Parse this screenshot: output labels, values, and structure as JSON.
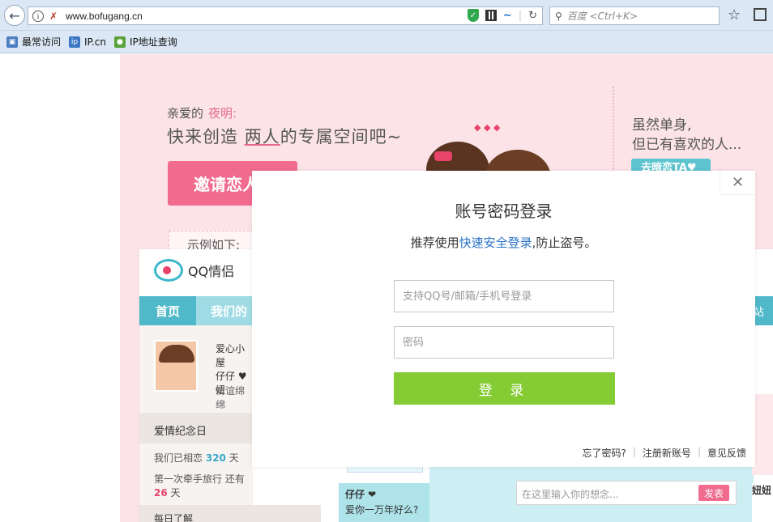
{
  "browser": {
    "url": "www.bofugang.cn",
    "search_placeholder": "百度 <Ctrl+K>",
    "bookmarks": [
      {
        "label": "最常访问",
        "icon": "bookmark-folder-icon"
      },
      {
        "label": "IP.cn",
        "icon": "ip-cn-icon"
      },
      {
        "label": "IP地址查询",
        "icon": "map-icon"
      }
    ]
  },
  "banner": {
    "greeting": "亲爱的",
    "nickname": "夜明:",
    "slogan_pre": "快来创造",
    "slogan_two": "两人",
    "slogan_post": "的专属空间吧~",
    "invite_button": "邀请恋人",
    "example_label": "示例如下:",
    "right_line1": "虽然单身,",
    "right_line2": "但已有喜欢的人...",
    "right_button": "去暗恋TA♥"
  },
  "preview": {
    "logo_text": "QQ情侣",
    "nav_home": "首页",
    "nav_ours": "我们的",
    "nav_right": "站",
    "house_title": "爱心小屋",
    "names": "仔仔 ♥ 妞",
    "status": "情谊绵绵",
    "anniversary_title": "爱情纪念日",
    "days_pre": "我们已相恋",
    "days_num": "320",
    "days_unit": "天",
    "trip_pre": "第一次牵手旅行 还有",
    "trip_num": "26",
    "trip_unit": "天",
    "daily_title": "每日了解",
    "note_name": "仔仔 ❤",
    "note_text": "爱你一万年好么?",
    "post_placeholder": "在这里输入你的想念...",
    "post_button": "发表",
    "right_name": "妞妞"
  },
  "login": {
    "title": "账号密码登录",
    "subtitle_pre": "推荐使用",
    "subtitle_link": "快速安全登录",
    "subtitle_post": ",防止盗号。",
    "username_placeholder": "支持QQ号/邮箱/手机号登录",
    "password_placeholder": "密码",
    "login_button": "登 录",
    "forgot": "忘了密码?",
    "register": "注册新账号",
    "feedback": "意见反馈"
  },
  "colors": {
    "banner_bg": "#fbe3e7",
    "accent_pink": "#f06b8e",
    "accent_teal": "#4fb8c9",
    "login_green": "#85cb33",
    "link_blue": "#2b73c6"
  }
}
